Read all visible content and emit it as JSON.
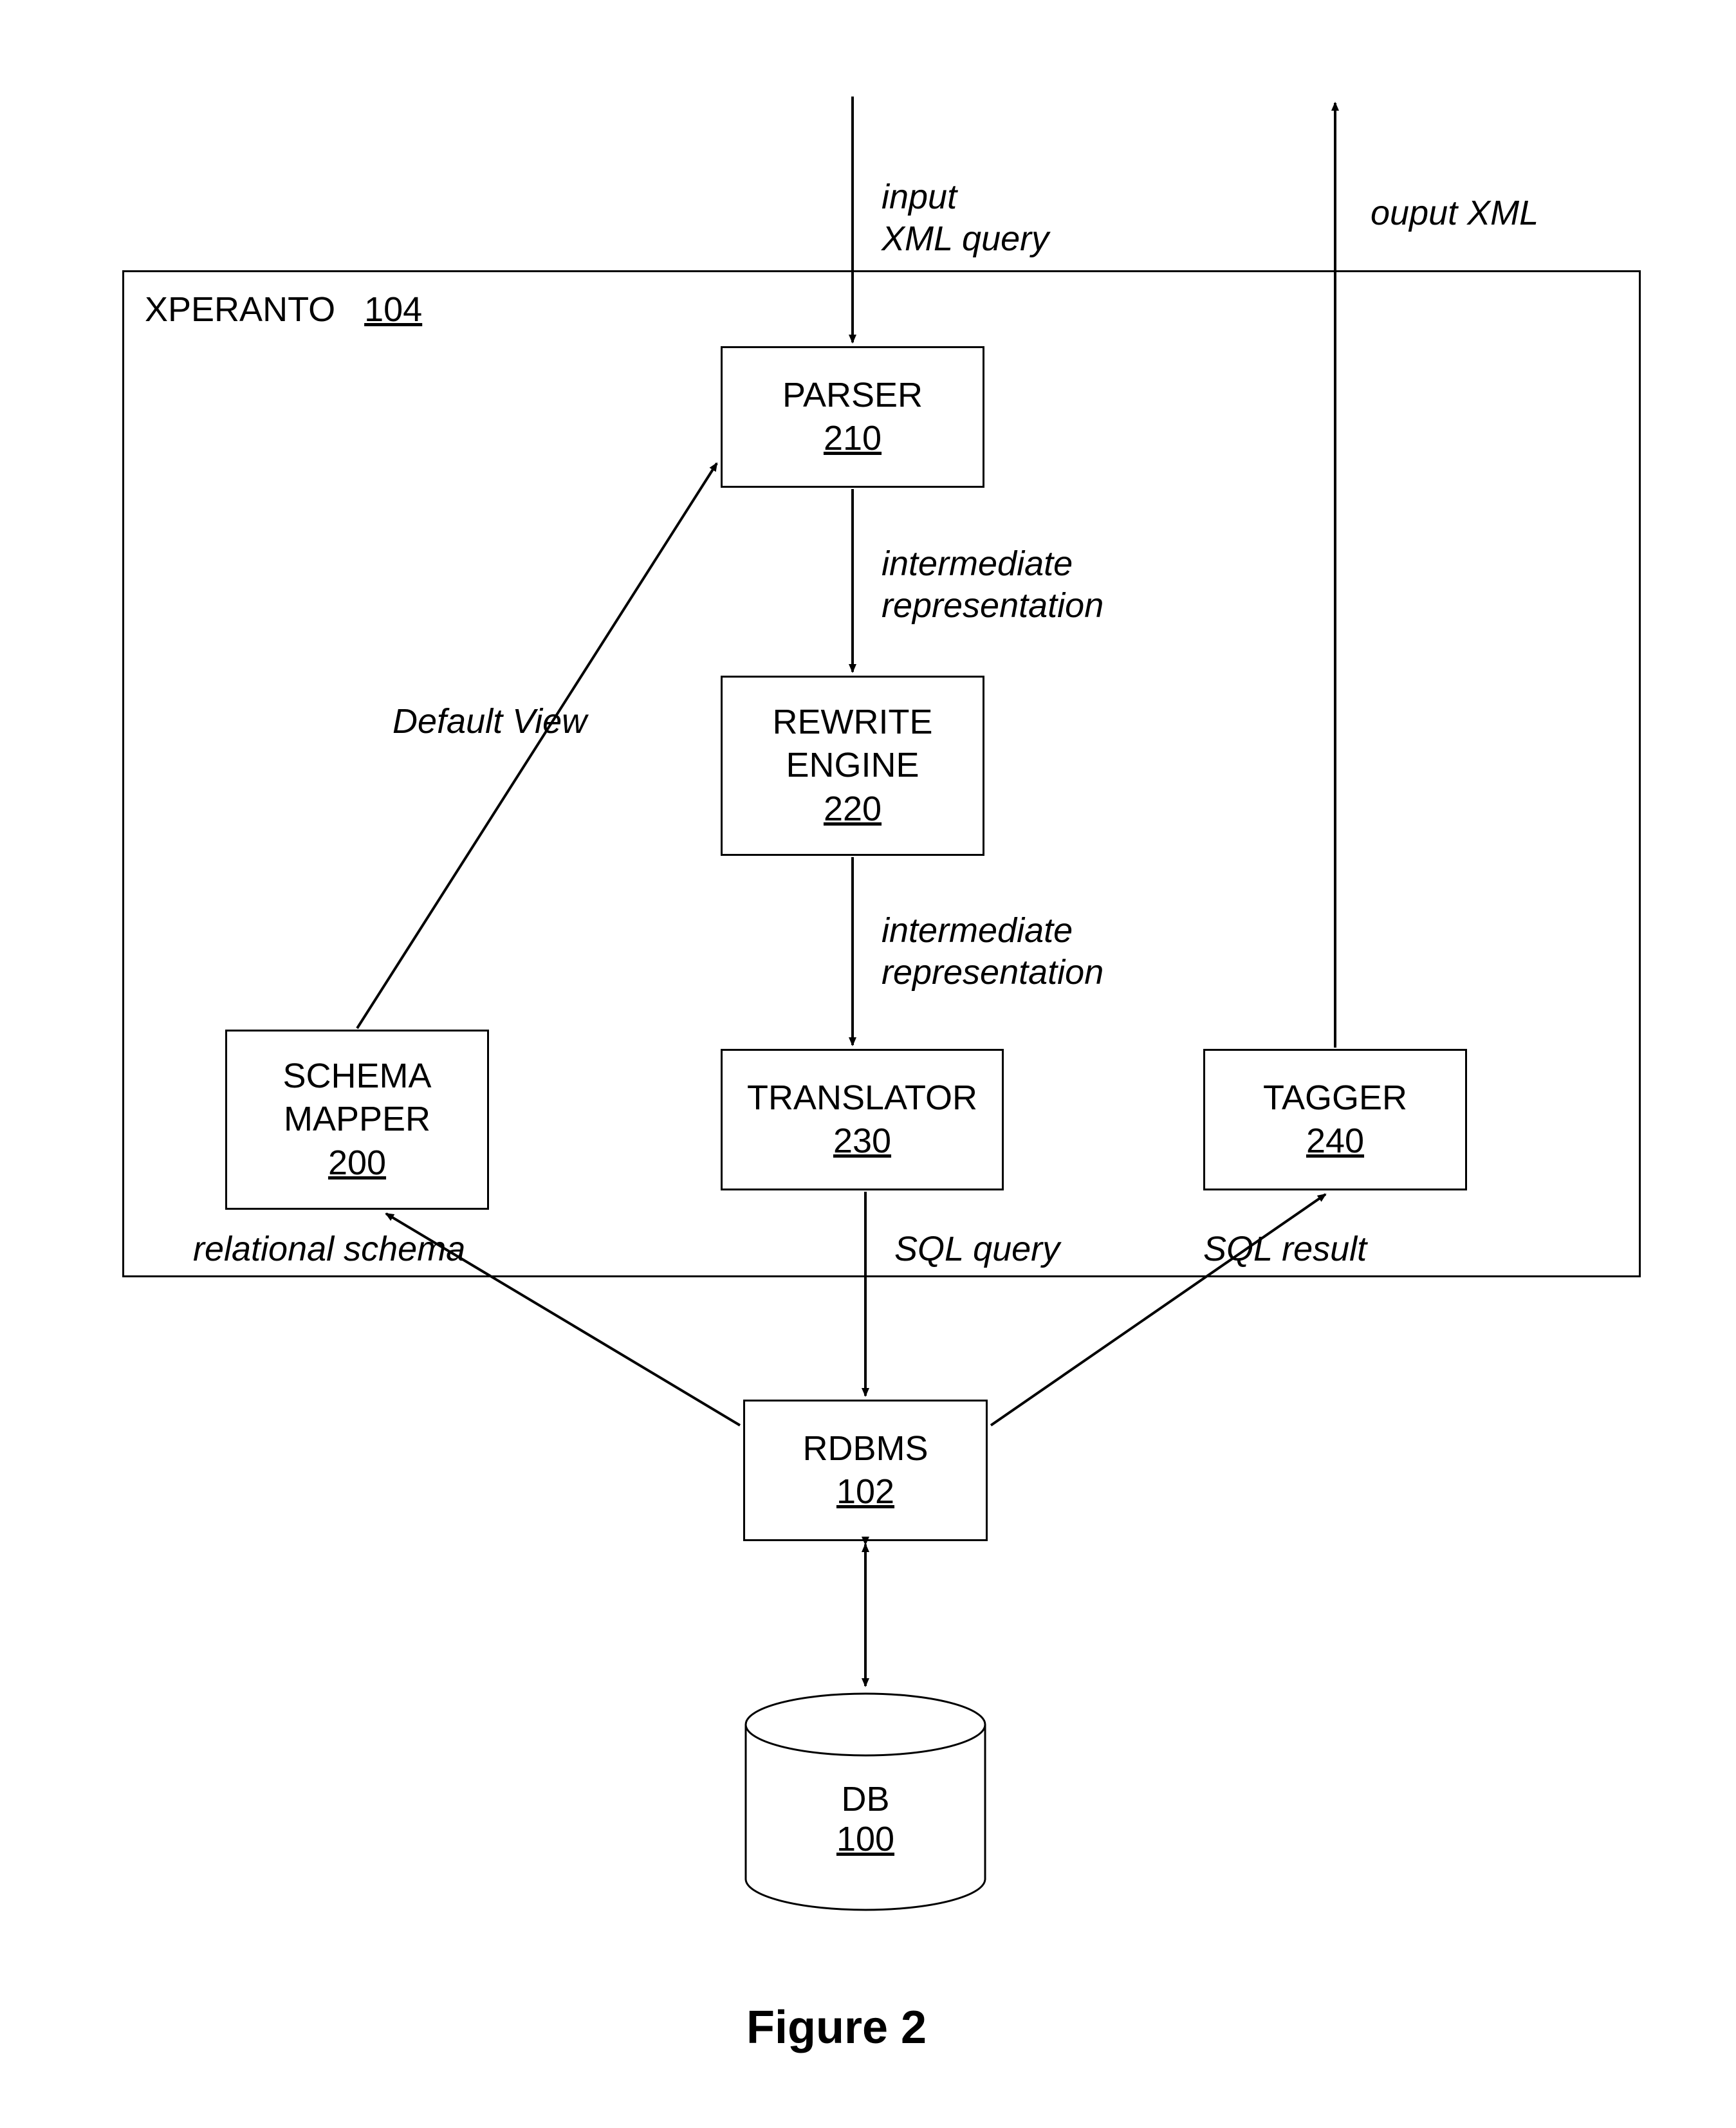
{
  "xperanto": {
    "name": "XPERANTO",
    "num": "104"
  },
  "blocks": {
    "parser": {
      "title": "PARSER",
      "num": "210"
    },
    "rewrite": {
      "title1": "REWRITE",
      "title2": "ENGINE",
      "num": "220"
    },
    "schema": {
      "title1": "SCHEMA",
      "title2": "MAPPER",
      "num": "200"
    },
    "translator": {
      "title": "TRANSLATOR",
      "num": "230"
    },
    "tagger": {
      "title": "TAGGER",
      "num": "240"
    },
    "rdbms": {
      "title": "RDBMS",
      "num": "102"
    },
    "db": {
      "title": "DB",
      "num": "100"
    }
  },
  "labels": {
    "input1": "input",
    "input2": "XML query",
    "output": "ouput XML",
    "inter1a": "intermediate",
    "inter1b": "representation",
    "inter2a": "intermediate",
    "inter2b": "representation",
    "defview": "Default View",
    "relschema": "relational schema",
    "sqlquery": "SQL query",
    "sqlresult": "SQL result"
  },
  "figure": "Figure 2"
}
